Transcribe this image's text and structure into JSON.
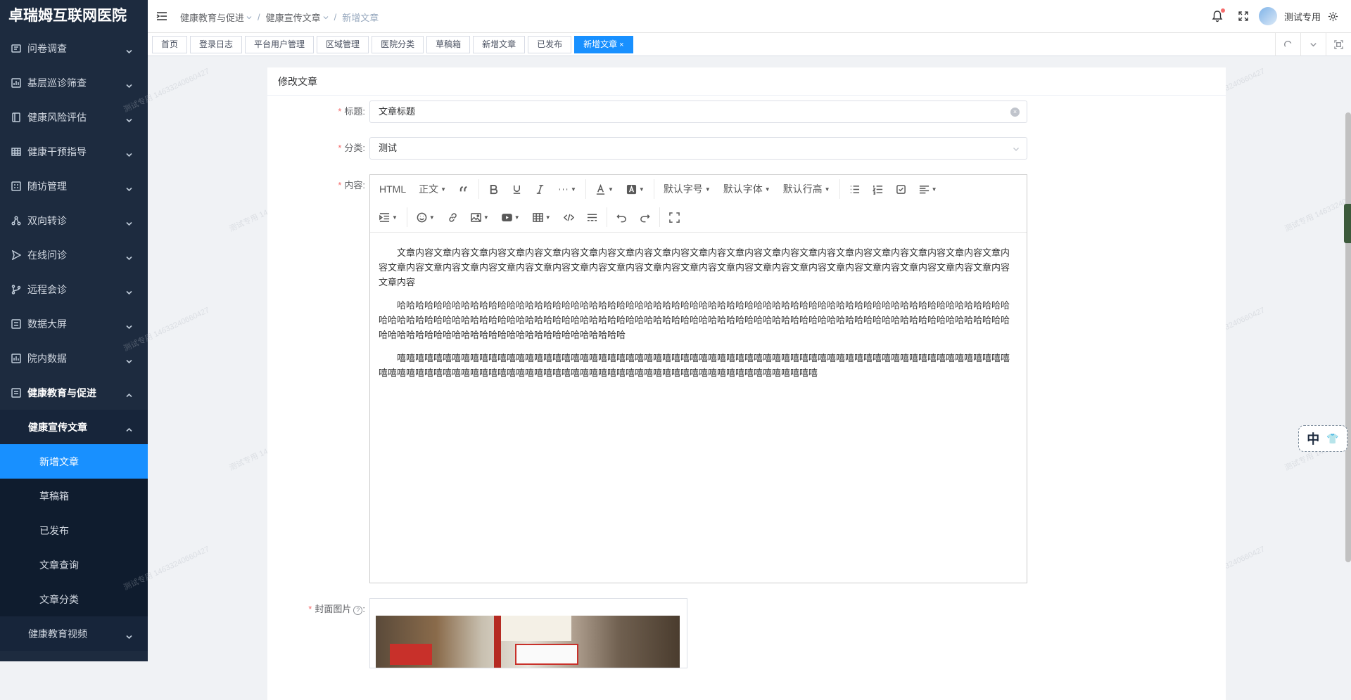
{
  "app": {
    "title": "卓瑞姆互联网医院"
  },
  "sidebar": {
    "items": [
      {
        "label": "问卷调查",
        "icon": "survey-icon"
      },
      {
        "label": "基层巡诊筛查",
        "icon": "chart-icon"
      },
      {
        "label": "健康风险评估",
        "icon": "document-icon"
      },
      {
        "label": "健康干预指导",
        "icon": "grid-icon"
      },
      {
        "label": "随访管理",
        "icon": "calendar-icon"
      },
      {
        "label": "双向转诊",
        "icon": "share-icon"
      },
      {
        "label": "在线问诊",
        "icon": "send-icon"
      },
      {
        "label": "远程会诊",
        "icon": "branch-icon"
      },
      {
        "label": "数据大屏",
        "icon": "screen-icon"
      },
      {
        "label": "院内数据",
        "icon": "data-icon"
      }
    ],
    "open_group": {
      "label": "健康教育与促进",
      "icon": "education-icon"
    },
    "open_sub": {
      "label": "健康宣传文章"
    },
    "sub_items": [
      {
        "label": "新增文章",
        "active": true
      },
      {
        "label": "草稿箱"
      },
      {
        "label": "已发布"
      },
      {
        "label": "文章查询"
      },
      {
        "label": "文章分类"
      }
    ],
    "after_item": {
      "label": "健康教育视频"
    }
  },
  "header": {
    "breadcrumb": [
      "健康教育与促进",
      "健康宣传文章",
      "新增文章"
    ],
    "username": "测试专用"
  },
  "tags": [
    {
      "label": "首页"
    },
    {
      "label": "登录日志"
    },
    {
      "label": "平台用户管理"
    },
    {
      "label": "区域管理"
    },
    {
      "label": "医院分类"
    },
    {
      "label": "草稿箱"
    },
    {
      "label": "新增文章"
    },
    {
      "label": "已发布"
    },
    {
      "label": "新增文章",
      "active": true,
      "close": "×"
    }
  ],
  "form": {
    "heading": "修改文章",
    "title_label": "标题:",
    "title_value": "文章标题",
    "category_label": "分类:",
    "category_value": "测试",
    "content_label": "内容:",
    "cover_label": "封面图片",
    "cover_help": "?",
    "cover_colon": ":",
    "required_mark": "*"
  },
  "editor": {
    "toolbar_row1": [
      "HTML",
      "正文",
      "quote-icon",
      "bold-icon",
      "underline-icon",
      "italic-icon",
      "more-icon",
      "font-color-icon",
      "bg-color-icon",
      "默认字号",
      "默认字体",
      "默认行高",
      "bullet-list-icon",
      "numbered-list-icon",
      "todo-icon",
      "align-icon"
    ],
    "html_label": "HTML",
    "para_label": "正文",
    "fontsize_label": "默认字号",
    "fontfamily_label": "默认字体",
    "lineheight_label": "默认行高",
    "paragraphs": [
      "文章内容文章内容文章内容文章内容文章内容文章内容文章内容文章内容文章内容文章内容文章内容文章内容文章内容文章内容文章内容文章内容文章内容文章内容文章内容文章内容文章内容文章内容文章内容文章内容文章内容文章内容文章内容文章内容文章内容文章内容文章内容文章内容文章内容文章内容文章内容",
      "哈哈哈哈哈哈哈哈哈哈哈哈哈哈哈哈哈哈哈哈哈哈哈哈哈哈哈哈哈哈哈哈哈哈哈哈哈哈哈哈哈哈哈哈哈哈哈哈哈哈哈哈哈哈哈哈哈哈哈哈哈哈哈哈哈哈哈哈哈哈哈哈哈哈哈哈哈哈哈哈哈哈哈哈哈哈哈哈哈哈哈哈哈哈哈哈哈哈哈哈哈哈哈哈哈哈哈哈哈哈哈哈哈哈哈哈哈哈哈哈哈哈哈哈哈哈哈哈哈哈哈哈哈哈哈哈哈哈哈哈哈哈哈哈哈哈哈哈哈哈哈哈哈哈哈哈哈哈哈哈哈哈哈",
      "嘻嘻嘻嘻嘻嘻嘻嘻嘻嘻嘻嘻嘻嘻嘻嘻嘻嘻嘻嘻嘻嘻嘻嘻嘻嘻嘻嘻嘻嘻嘻嘻嘻嘻嘻嘻嘻嘻嘻嘻嘻嘻嘻嘻嘻嘻嘻嘻嘻嘻嘻嘻嘻嘻嘻嘻嘻嘻嘻嘻嘻嘻嘻嘻嘻嘻嘻嘻嘻嘻嘻嘻嘻嘻嘻嘻嘻嘻嘻嘻嘻嘻嘻嘻嘻嘻嘻嘻嘻嘻嘻嘻嘻嘻嘻嘻嘻嘻嘻嘻嘻嘻嘻嘻嘻嘻嘻嘻嘻嘻嘻嘻嘻嘻嘻"
    ]
  },
  "ime": {
    "label": "中",
    "shirt": "👕"
  },
  "watermark": "测试专用 14633240660427"
}
